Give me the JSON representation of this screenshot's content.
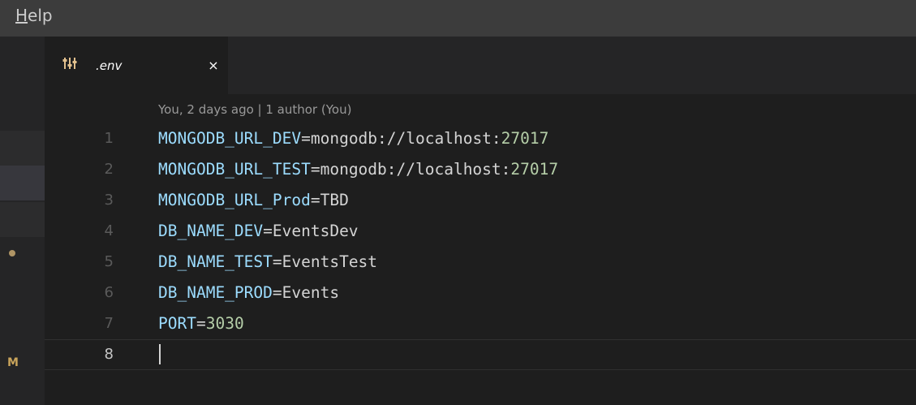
{
  "menu": {
    "help_mnemonic": "H",
    "help_rest": "elp"
  },
  "tab": {
    "label": ".env",
    "icon": "settings-sliders-icon",
    "close_symbol": "×"
  },
  "gutter": {
    "modified_letter": "M"
  },
  "editor": {
    "blame": "You, 2 days ago | 1 author (You)",
    "lines": [
      {
        "number": "1",
        "key": "MONGODB_URL_DEV",
        "eq": "=",
        "value": "mongodb://localhost:",
        "value_num": "27017"
      },
      {
        "number": "2",
        "key": "MONGODB_URL_TEST",
        "eq": "=",
        "value": "mongodb://localhost:",
        "value_num": "27017"
      },
      {
        "number": "3",
        "key": "MONGODB_URL_Prod",
        "eq": "=",
        "value": "TBD",
        "value_num": ""
      },
      {
        "number": "4",
        "key": "DB_NAME_DEV",
        "eq": "=",
        "value": "EventsDev",
        "value_num": ""
      },
      {
        "number": "5",
        "key": "DB_NAME_TEST",
        "eq": "=",
        "value": "EventsTest",
        "value_num": ""
      },
      {
        "number": "6",
        "key": "DB_NAME_PROD",
        "eq": "=",
        "value": "Events",
        "value_num": ""
      },
      {
        "number": "7",
        "key": "PORT",
        "eq": "=",
        "value": "",
        "value_num": "3030"
      },
      {
        "number": "8",
        "key": "",
        "eq": "",
        "value": "",
        "value_num": ""
      }
    ],
    "current_line": 8
  },
  "colors": {
    "background": "#1e1e1e",
    "menubar": "#3c3c3c",
    "key": "#9cdcfe",
    "number": "#b5cea8",
    "text": "#d4d4d4",
    "blame": "#999999",
    "line_number": "#5a5a5a",
    "modified": "#c9a45b"
  }
}
